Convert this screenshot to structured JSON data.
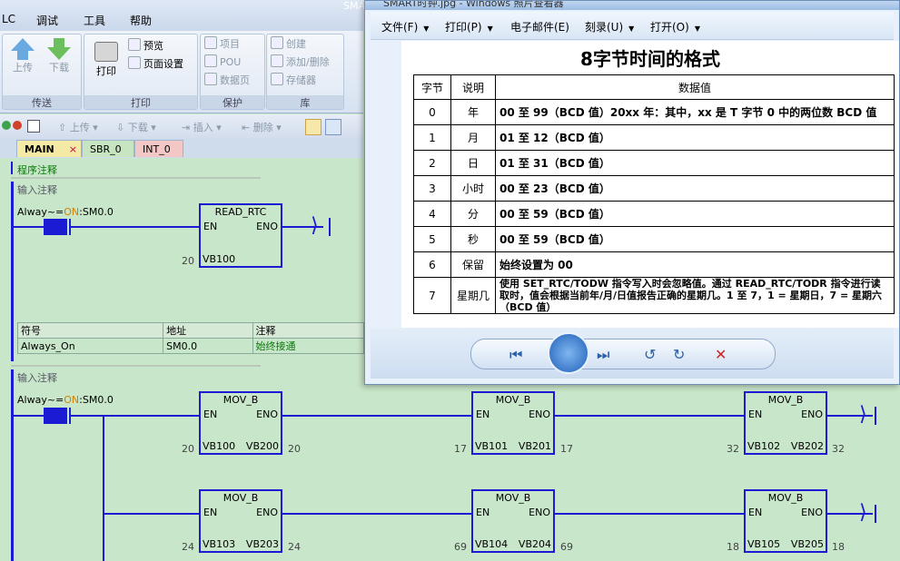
{
  "app": {
    "menu": [
      "LC",
      "调试",
      "工具",
      "帮助"
    ],
    "title_fragment": "SMAR"
  },
  "ribbon": {
    "groups": [
      {
        "title": "传送",
        "buttons": [
          "上传",
          "下载"
        ]
      },
      {
        "title": "打印",
        "buttons": [
          "打印",
          "预览",
          "页面设置"
        ]
      },
      {
        "title": "保护",
        "buttons": [
          "项目",
          "POU",
          "数据页"
        ]
      },
      {
        "title": "库",
        "buttons": [
          "创建",
          "添加/删除",
          "存储器"
        ]
      }
    ]
  },
  "toolbar": {
    "items": [
      "上传",
      "下载",
      "插入",
      "删除"
    ]
  },
  "tabs": [
    {
      "label": "MAIN",
      "close": "×"
    },
    {
      "label": "SBR_0"
    },
    {
      "label": "INT_0"
    }
  ],
  "program": {
    "comment": "程序注释",
    "networks": [
      {
        "comment": "输入注释",
        "contact": {
          "label_prefix": "Alway~=",
          "state": "ON",
          "label_suffix": ":SM0.0"
        },
        "blocks": [
          {
            "name": "READ_RTC",
            "en": "EN",
            "eno": "ENO",
            "in_value": "20",
            "in": "VB100"
          }
        ],
        "symbols": {
          "headers": [
            "符号",
            "地址",
            "注释"
          ],
          "rows": [
            [
              "Always_On",
              "SM0.0",
              "始终接通"
            ]
          ]
        }
      },
      {
        "comment": "输入注释",
        "contact": {
          "label_prefix": "Alway~=",
          "state": "ON",
          "label_suffix": ":SM0.0"
        },
        "blocks": [
          {
            "name": "MOV_B",
            "en": "EN",
            "eno": "ENO",
            "in_value": "20",
            "in": "VB100",
            "out": "VB200",
            "out_value": "20"
          },
          {
            "name": "MOV_B",
            "en": "EN",
            "eno": "ENO",
            "in_value": "17",
            "in": "VB101",
            "out": "VB201",
            "out_value": "17"
          },
          {
            "name": "MOV_B",
            "en": "EN",
            "eno": "ENO",
            "in_value": "32",
            "in": "VB102",
            "out": "VB202",
            "out_value": "32"
          },
          {
            "name": "MOV_B",
            "en": "EN",
            "eno": "ENO",
            "in_value": "24",
            "in": "VB103",
            "out": "VB203",
            "out_value": "24"
          },
          {
            "name": "MOV_B",
            "en": "EN",
            "eno": "ENO",
            "in_value": "69",
            "in": "VB104",
            "out": "VB204",
            "out_value": "69"
          },
          {
            "name": "MOV_B",
            "en": "EN",
            "eno": "ENO",
            "in_value": "18",
            "in": "VB105",
            "out": "VB205",
            "out_value": "18"
          }
        ]
      }
    ]
  },
  "viewer": {
    "title": "SMART时钟.jpg - Windows 照片查看器",
    "menu": [
      "文件(F)",
      "打印(P)",
      "电子邮件(E)",
      "刻录(U)",
      "打开(O)"
    ],
    "image": {
      "title": "8字节时间的格式",
      "headers": [
        "字节",
        "说明",
        "数据值"
      ],
      "rows": [
        [
          "0",
          "年",
          "00 至 99（BCD 值）20xx 年：其中，xx 是 T 字节 0 中的两位数 BCD 值"
        ],
        [
          "1",
          "月",
          "01 至 12（BCD 值）"
        ],
        [
          "2",
          "日",
          "01 至 31（BCD 值）"
        ],
        [
          "3",
          "小时",
          "00 至 23（BCD 值）"
        ],
        [
          "4",
          "分",
          "00 至 59（BCD 值）"
        ],
        [
          "5",
          "秒",
          "00 至 59（BCD 值）"
        ],
        [
          "6",
          "保留",
          "始终设置为 00"
        ],
        [
          "7",
          "星期几",
          "使用 SET_RTC/TODW 指令写入时会忽略值。通过 READ_RTC/TODR 指令进行读取时，值会根据当前年/月/日值报告正确的星期几。1 至 7，1 = 星期日，7 = 星期六（BCD 值）"
        ]
      ]
    },
    "controls": [
      "zoom-icon",
      "fit-icon",
      "previous-icon",
      "slideshow-icon",
      "next-icon",
      "rotate-ccw-icon",
      "rotate-cw-icon",
      "delete-icon"
    ]
  }
}
